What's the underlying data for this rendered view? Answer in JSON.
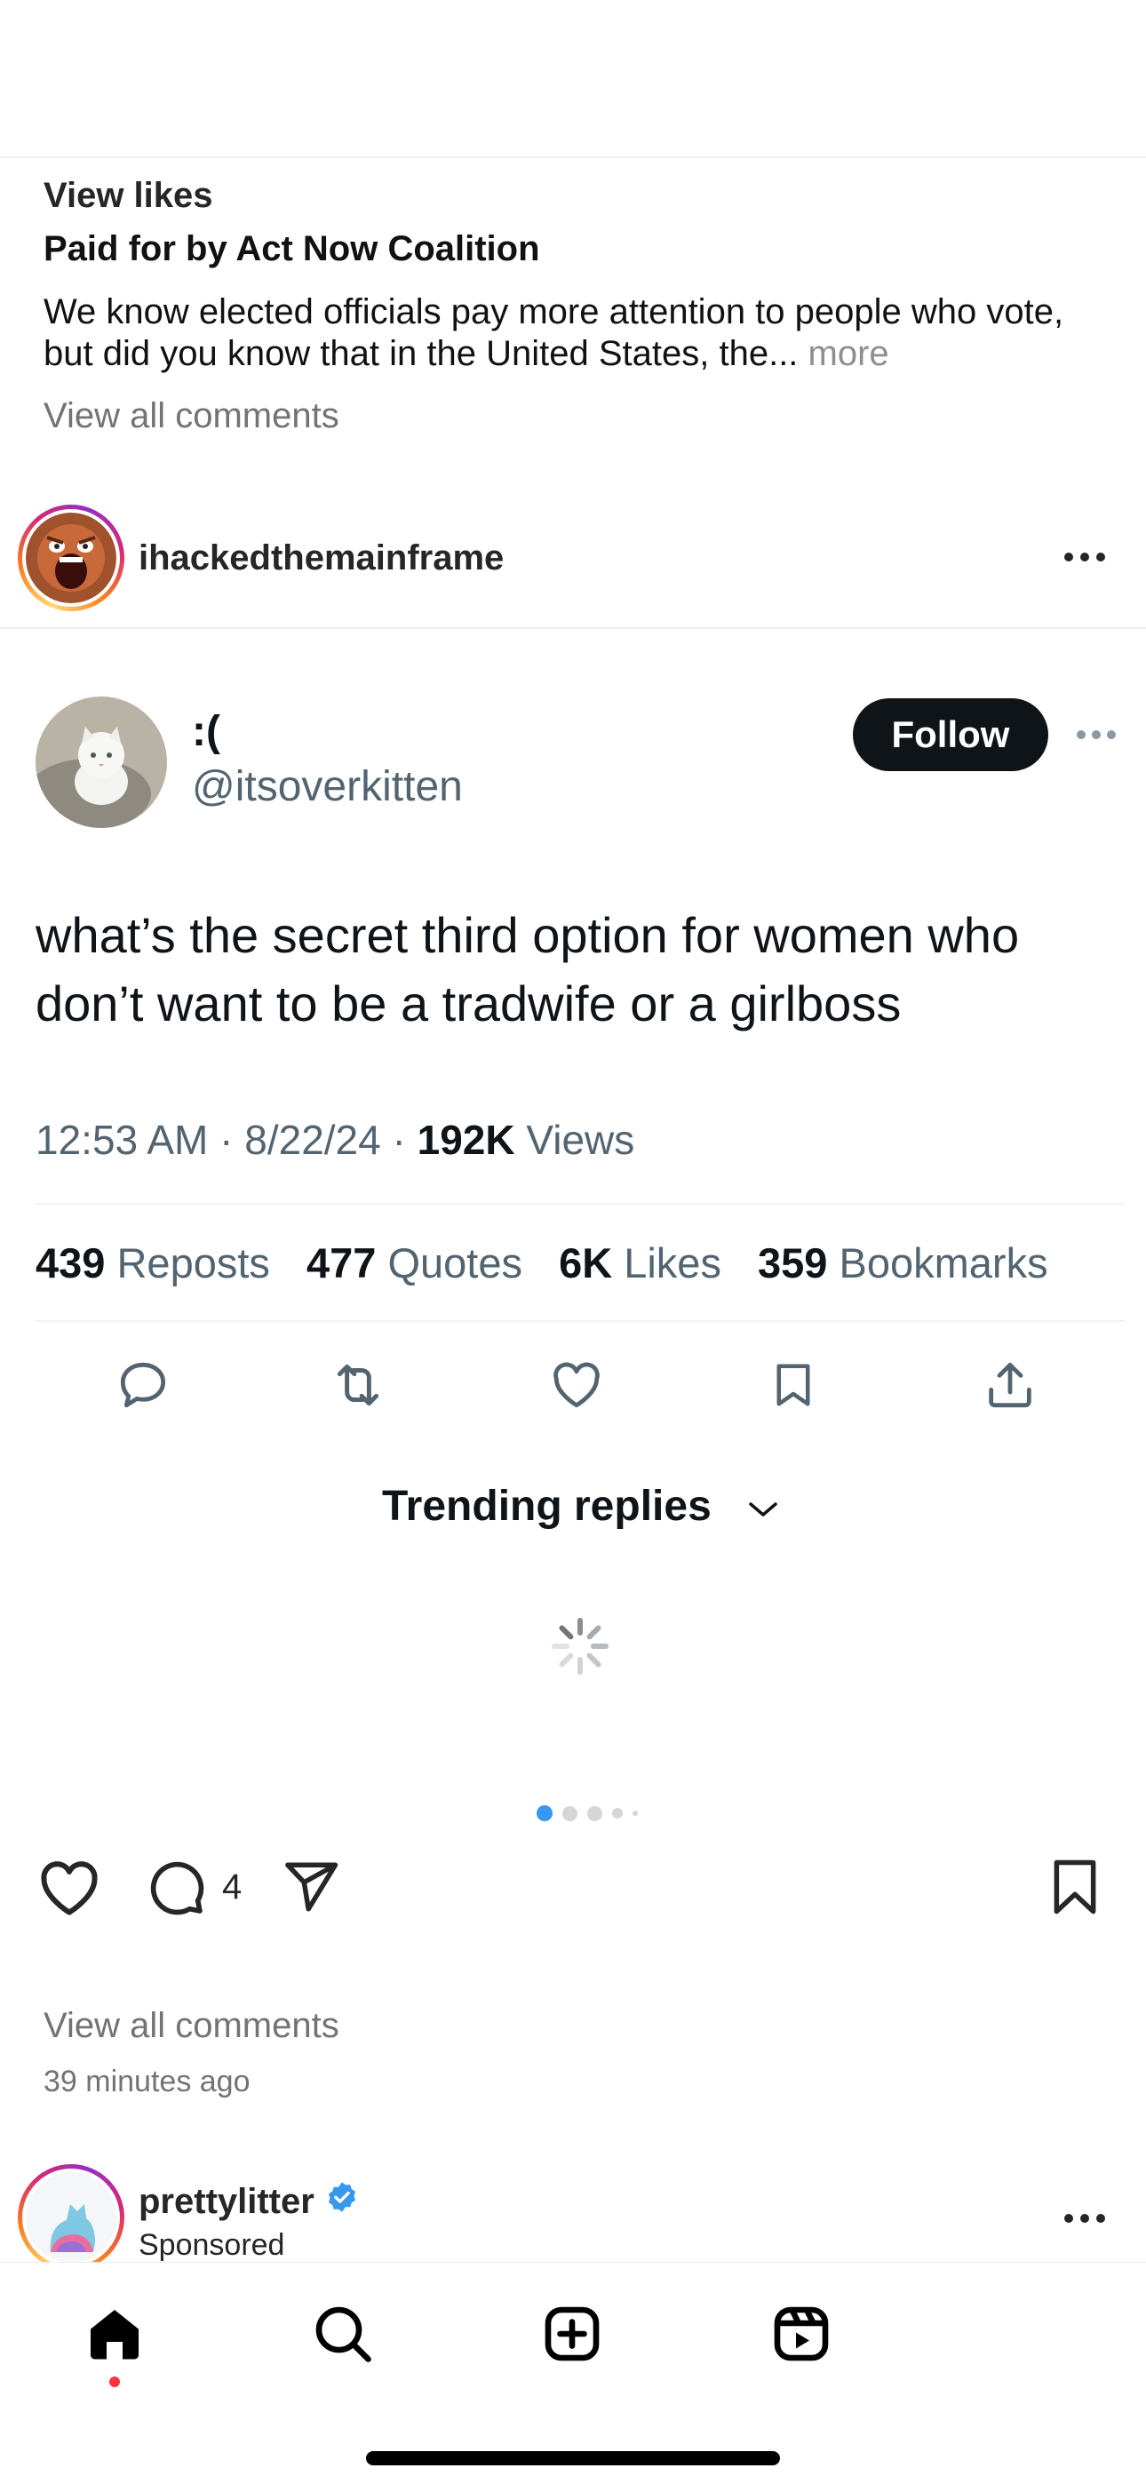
{
  "ad_post": {
    "view_likes": "View likes",
    "paid_for": "Paid for by Act Now Coalition",
    "caption": "We know elected officials pay more attention to people who vote, but did you know that in the United States, the...",
    "caption_more": "more",
    "view_all_comments": "View all comments"
  },
  "post": {
    "username": "ihackedthemainframe",
    "tweet": {
      "display_name": ":(",
      "handle": "@itsoverkitten",
      "follow_label": "Follow",
      "text": "what’s the secret third option for women who don’t want to be a tradwife or a girlboss",
      "time": "12:53 AM",
      "date": "8/22/24",
      "views_count": "192K",
      "views_label": "Views",
      "reposts_count": "439",
      "reposts_label": "Reposts",
      "quotes_count": "477",
      "quotes_label": "Quotes",
      "likes_count": "6K",
      "likes_label": "Likes",
      "bookmarks_count": "359",
      "bookmarks_label": "Bookmarks",
      "trending_label": "Trending replies"
    },
    "carousel": {
      "active_index": 0,
      "total": 5
    },
    "comment_count": "4",
    "view_all_comments": "View all comments",
    "time_ago": "39 minutes ago"
  },
  "next_post": {
    "username": "prettylitter",
    "sponsored": "Sponsored",
    "verified": true
  },
  "colors": {
    "accent_blue": "#3897f0",
    "notification_red": "#ff3040",
    "follow_button": "#0f1419"
  },
  "bottom_nav": {
    "items": [
      "home-icon",
      "search-icon",
      "create-icon",
      "reels-icon"
    ],
    "active": "home-icon"
  }
}
